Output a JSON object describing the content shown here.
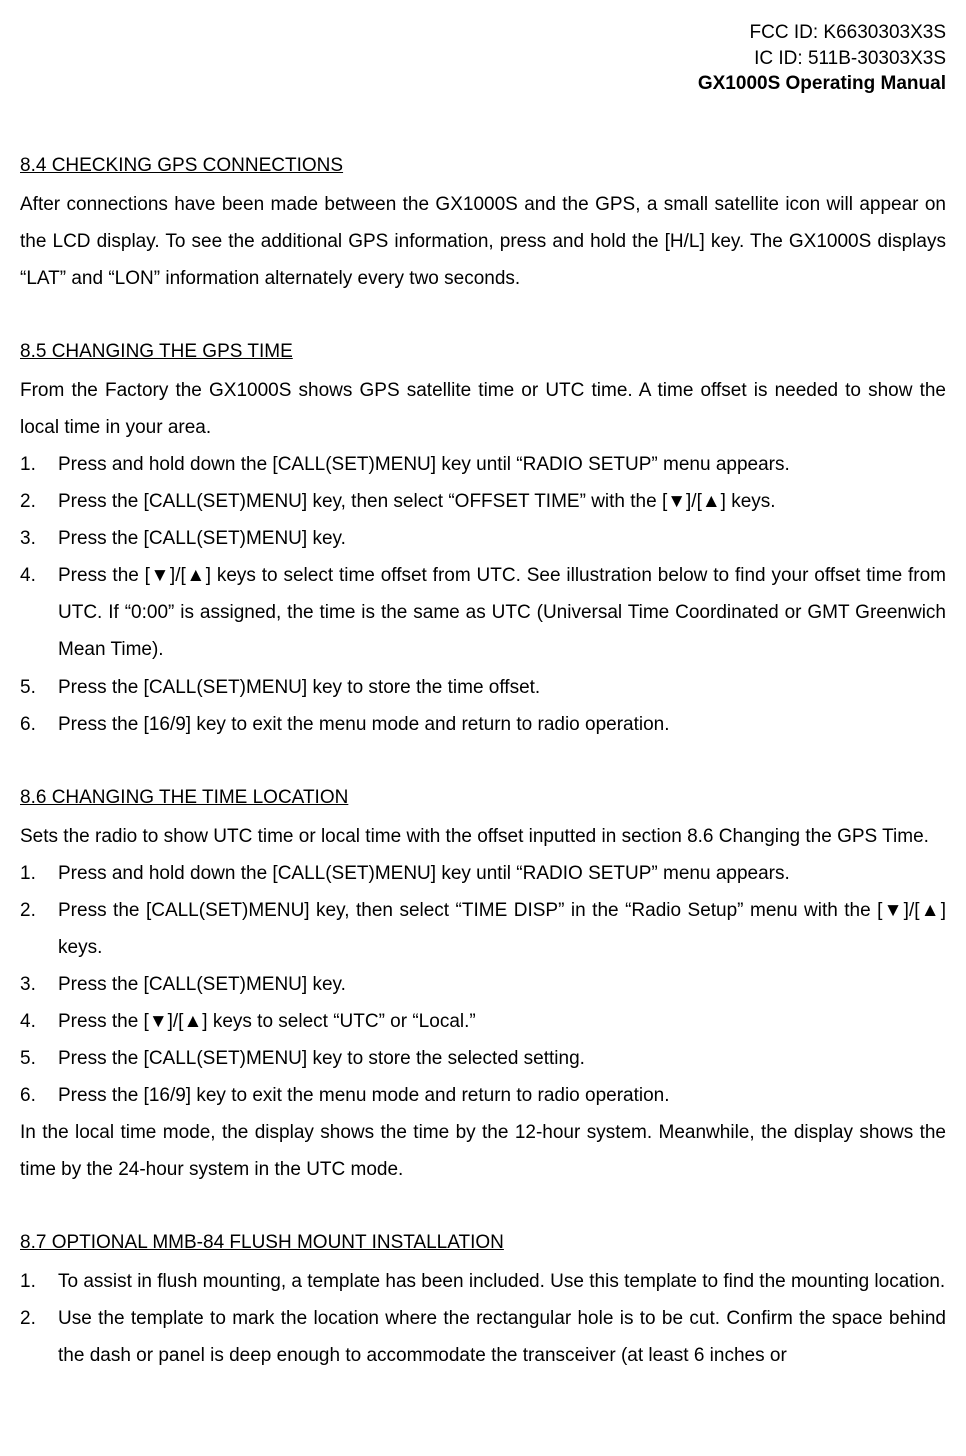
{
  "header": {
    "fcc": "FCC ID: K6630303X3S",
    "ic": "IC ID: 511B-30303X3S",
    "manual": "GX1000S Operating Manual"
  },
  "sec84": {
    "heading": "8.4    CHECKING GPS CONNECTIONS",
    "para": "After connections have been made between the GX1000S and the GPS, a small satellite icon will appear on the LCD display. To see the additional GPS information, press and hold the [H/L] key. The GX1000S displays “LAT” and “LON” information alternately every two seconds."
  },
  "sec85": {
    "heading": "8.5    CHANGING THE GPS TIME",
    "intro": "From the Factory the GX1000S shows GPS satellite time or UTC time. A time offset is needed to show the local time in your area.",
    "items": [
      "Press and hold down the [CALL(SET)MENU] key until “RADIO SETUP” menu appears.",
      "Press the [CALL(SET)MENU] key, then select “OFFSET TIME” with the [▼]/[▲] keys.",
      "Press the [CALL(SET)MENU] key.",
      "Press the [▼]/[▲] keys to select time offset from UTC. See illustration below to find your offset time from UTC. If “0:00” is assigned, the time is the same as UTC (Universal Time Coordinated or GMT Greenwich Mean Time).",
      "Press the [CALL(SET)MENU] key to store the time offset.",
      "Press the [16/9] key to exit the menu mode and return to radio operation."
    ]
  },
  "sec86": {
    "heading": "8.6    CHANGING THE TIME LOCATION",
    "intro": "Sets the radio to show UTC time or local time with the offset inputted in section 8.6 Changing the GPS Time.",
    "items": [
      "Press and hold down the [CALL(SET)MENU] key until “RADIO SETUP” menu appears.",
      "Press the [CALL(SET)MENU] key, then select “TIME DISP” in the “Radio Setup” menu with the [▼]/[▲] keys.",
      "Press the [CALL(SET)MENU] key.",
      "Press the [▼]/[▲] keys to select “UTC” or “Local.”",
      "Press the [CALL(SET)MENU] key to store    the selected setting.",
      "Press the [16/9] key to exit the menu mode and return to radio operation."
    ],
    "trail": "In the local time mode, the display shows the time by the 12-hour system. Meanwhile, the display shows the time by the 24-hour system in the UTC mode."
  },
  "sec87": {
    "heading": "8.7    OPTIONAL MMB-84 FLUSH MOUNT INSTALLATION",
    "items": [
      "To assist in flush mounting, a template has been included. Use this template to find the mounting location.",
      "Use the template to mark the location where the rectangular hole is to be cut. Confirm the space behind the dash or panel is deep enough to accommodate the transceiver (at least 6 inches or"
    ]
  }
}
